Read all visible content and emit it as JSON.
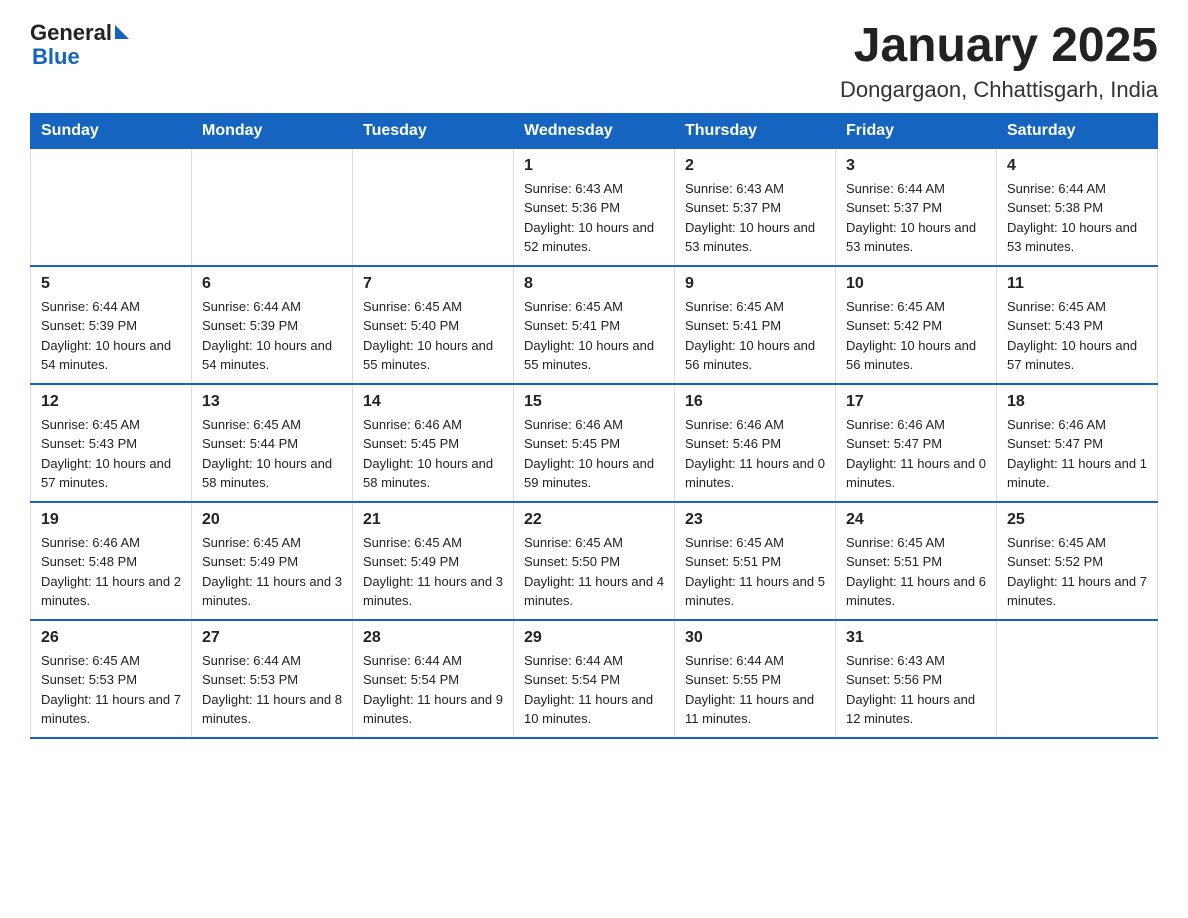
{
  "logo": {
    "general": "General",
    "blue": "Blue"
  },
  "title": "January 2025",
  "subtitle": "Dongargaon, Chhattisgarh, India",
  "weekdays": [
    "Sunday",
    "Monday",
    "Tuesday",
    "Wednesday",
    "Thursday",
    "Friday",
    "Saturday"
  ],
  "weeks": [
    [
      {
        "day": "",
        "info": ""
      },
      {
        "day": "",
        "info": ""
      },
      {
        "day": "",
        "info": ""
      },
      {
        "day": "1",
        "info": "Sunrise: 6:43 AM\nSunset: 5:36 PM\nDaylight: 10 hours and 52 minutes."
      },
      {
        "day": "2",
        "info": "Sunrise: 6:43 AM\nSunset: 5:37 PM\nDaylight: 10 hours and 53 minutes."
      },
      {
        "day": "3",
        "info": "Sunrise: 6:44 AM\nSunset: 5:37 PM\nDaylight: 10 hours and 53 minutes."
      },
      {
        "day": "4",
        "info": "Sunrise: 6:44 AM\nSunset: 5:38 PM\nDaylight: 10 hours and 53 minutes."
      }
    ],
    [
      {
        "day": "5",
        "info": "Sunrise: 6:44 AM\nSunset: 5:39 PM\nDaylight: 10 hours and 54 minutes."
      },
      {
        "day": "6",
        "info": "Sunrise: 6:44 AM\nSunset: 5:39 PM\nDaylight: 10 hours and 54 minutes."
      },
      {
        "day": "7",
        "info": "Sunrise: 6:45 AM\nSunset: 5:40 PM\nDaylight: 10 hours and 55 minutes."
      },
      {
        "day": "8",
        "info": "Sunrise: 6:45 AM\nSunset: 5:41 PM\nDaylight: 10 hours and 55 minutes."
      },
      {
        "day": "9",
        "info": "Sunrise: 6:45 AM\nSunset: 5:41 PM\nDaylight: 10 hours and 56 minutes."
      },
      {
        "day": "10",
        "info": "Sunrise: 6:45 AM\nSunset: 5:42 PM\nDaylight: 10 hours and 56 minutes."
      },
      {
        "day": "11",
        "info": "Sunrise: 6:45 AM\nSunset: 5:43 PM\nDaylight: 10 hours and 57 minutes."
      }
    ],
    [
      {
        "day": "12",
        "info": "Sunrise: 6:45 AM\nSunset: 5:43 PM\nDaylight: 10 hours and 57 minutes."
      },
      {
        "day": "13",
        "info": "Sunrise: 6:45 AM\nSunset: 5:44 PM\nDaylight: 10 hours and 58 minutes."
      },
      {
        "day": "14",
        "info": "Sunrise: 6:46 AM\nSunset: 5:45 PM\nDaylight: 10 hours and 58 minutes."
      },
      {
        "day": "15",
        "info": "Sunrise: 6:46 AM\nSunset: 5:45 PM\nDaylight: 10 hours and 59 minutes."
      },
      {
        "day": "16",
        "info": "Sunrise: 6:46 AM\nSunset: 5:46 PM\nDaylight: 11 hours and 0 minutes."
      },
      {
        "day": "17",
        "info": "Sunrise: 6:46 AM\nSunset: 5:47 PM\nDaylight: 11 hours and 0 minutes."
      },
      {
        "day": "18",
        "info": "Sunrise: 6:46 AM\nSunset: 5:47 PM\nDaylight: 11 hours and 1 minute."
      }
    ],
    [
      {
        "day": "19",
        "info": "Sunrise: 6:46 AM\nSunset: 5:48 PM\nDaylight: 11 hours and 2 minutes."
      },
      {
        "day": "20",
        "info": "Sunrise: 6:45 AM\nSunset: 5:49 PM\nDaylight: 11 hours and 3 minutes."
      },
      {
        "day": "21",
        "info": "Sunrise: 6:45 AM\nSunset: 5:49 PM\nDaylight: 11 hours and 3 minutes."
      },
      {
        "day": "22",
        "info": "Sunrise: 6:45 AM\nSunset: 5:50 PM\nDaylight: 11 hours and 4 minutes."
      },
      {
        "day": "23",
        "info": "Sunrise: 6:45 AM\nSunset: 5:51 PM\nDaylight: 11 hours and 5 minutes."
      },
      {
        "day": "24",
        "info": "Sunrise: 6:45 AM\nSunset: 5:51 PM\nDaylight: 11 hours and 6 minutes."
      },
      {
        "day": "25",
        "info": "Sunrise: 6:45 AM\nSunset: 5:52 PM\nDaylight: 11 hours and 7 minutes."
      }
    ],
    [
      {
        "day": "26",
        "info": "Sunrise: 6:45 AM\nSunset: 5:53 PM\nDaylight: 11 hours and 7 minutes."
      },
      {
        "day": "27",
        "info": "Sunrise: 6:44 AM\nSunset: 5:53 PM\nDaylight: 11 hours and 8 minutes."
      },
      {
        "day": "28",
        "info": "Sunrise: 6:44 AM\nSunset: 5:54 PM\nDaylight: 11 hours and 9 minutes."
      },
      {
        "day": "29",
        "info": "Sunrise: 6:44 AM\nSunset: 5:54 PM\nDaylight: 11 hours and 10 minutes."
      },
      {
        "day": "30",
        "info": "Sunrise: 6:44 AM\nSunset: 5:55 PM\nDaylight: 11 hours and 11 minutes."
      },
      {
        "day": "31",
        "info": "Sunrise: 6:43 AM\nSunset: 5:56 PM\nDaylight: 11 hours and 12 minutes."
      },
      {
        "day": "",
        "info": ""
      }
    ]
  ]
}
